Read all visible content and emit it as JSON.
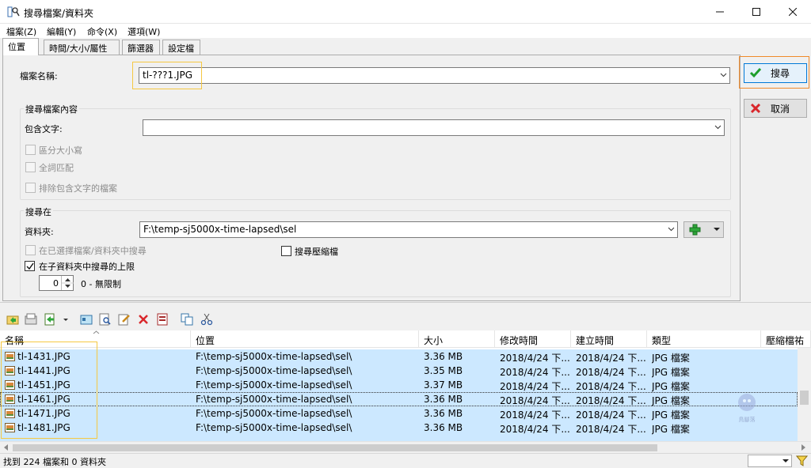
{
  "window": {
    "title": "搜尋檔案/資料夾"
  },
  "menu": [
    "檔案(Z)",
    "編輯(Y)",
    "命令(X)",
    "選項(W)"
  ],
  "tabs": [
    "位置",
    "時間/大小/屬性",
    "篩選器",
    "設定檔"
  ],
  "location": {
    "filename_label": "檔案名稱:",
    "filename_value": "tl-???1.JPG",
    "content_group": "搜尋檔案內容",
    "contains_label": "包含文字:",
    "contains_value": "",
    "case_sensitive": "區分大小寫",
    "whole_word": "全詞匹配",
    "exclude_containing": "排除包含文字的檔案",
    "search_in_group": "搜尋在",
    "folder_label": "資料夾:",
    "folder_value": "F:\\temp-sj5000x-time-lapsed\\sel",
    "in_selected": "在已選擇檔案/資料夾中搜尋",
    "search_archives": "搜尋壓縮檔",
    "subfolder_limit": "在子資料夾中搜尋的上限",
    "depth_value": "0",
    "depth_hint": "0 - 無限制"
  },
  "buttons": {
    "search": "搜尋",
    "cancel": "取消"
  },
  "results": {
    "columns": [
      "名稱",
      "位置",
      "大小",
      "修改時間",
      "建立時間",
      "類型",
      "壓縮檔祐"
    ],
    "rows": [
      {
        "name": "tl-1431.JPG",
        "path": "F:\\temp-sj5000x-time-lapsed\\sel\\",
        "size": "3.36 MB",
        "modified": "2018/4/24 下...",
        "created": "2018/4/24 下...",
        "type": "JPG 檔案"
      },
      {
        "name": "tl-1441.JPG",
        "path": "F:\\temp-sj5000x-time-lapsed\\sel\\",
        "size": "3.35 MB",
        "modified": "2018/4/24 下...",
        "created": "2018/4/24 下...",
        "type": "JPG 檔案"
      },
      {
        "name": "tl-1451.JPG",
        "path": "F:\\temp-sj5000x-time-lapsed\\sel\\",
        "size": "3.37 MB",
        "modified": "2018/4/24 下...",
        "created": "2018/4/24 下...",
        "type": "JPG 檔案"
      },
      {
        "name": "tl-1461.JPG",
        "path": "F:\\temp-sj5000x-time-lapsed\\sel\\",
        "size": "3.36 MB",
        "modified": "2018/4/24 下...",
        "created": "2018/4/24 下...",
        "type": "JPG 檔案"
      },
      {
        "name": "tl-1471.JPG",
        "path": "F:\\temp-sj5000x-time-lapsed\\sel\\",
        "size": "3.36 MB",
        "modified": "2018/4/24 下...",
        "created": "2018/4/24 下...",
        "type": "JPG 檔案"
      },
      {
        "name": "tl-1481.JPG",
        "path": "F:\\temp-sj5000x-time-lapsed\\sel\\",
        "size": "3.36 MB",
        "modified": "2018/4/24 下...",
        "created": "2018/4/24 下...",
        "type": "JPG 檔案"
      }
    ]
  },
  "status": {
    "text": "找到 224 檔案和 0 資料夾"
  },
  "watermark": {
    "text": "鳥腳落"
  },
  "colors": {
    "selection": "#cce8ff",
    "ok_green": "#1f9e2c",
    "cancel_red": "#d9262b",
    "highlight_yellow": "#f5c842",
    "highlight_orange": "#f08a2a"
  }
}
